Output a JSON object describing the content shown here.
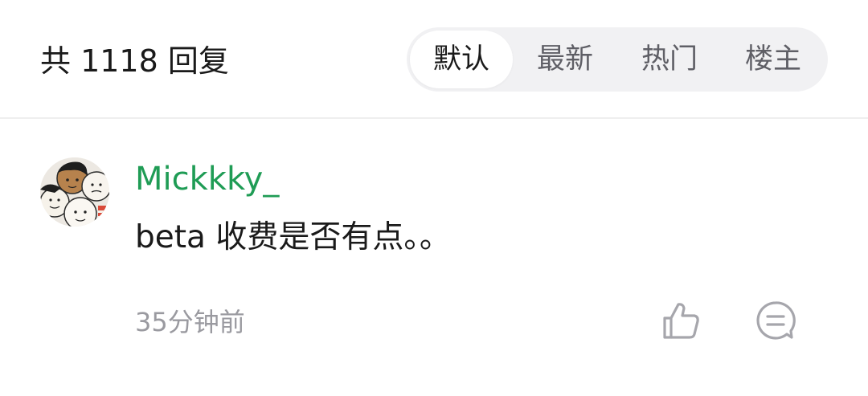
{
  "header": {
    "reply_count": "共 1118 回复",
    "sort_tabs": [
      {
        "label": "默认",
        "active": true
      },
      {
        "label": "最新",
        "active": false
      },
      {
        "label": "热门",
        "active": false
      },
      {
        "label": "楼主",
        "active": false
      }
    ]
  },
  "comment": {
    "avatar_icon": "avatar-cartoon-icon",
    "username": "Mickkky_",
    "text": "beta 收费是否有点。。",
    "time": "35分钟前",
    "actions": {
      "like_icon": "thumbs-up-icon",
      "reply_icon": "comment-bubble-icon"
    }
  },
  "colors": {
    "username": "#1f9c55",
    "secondary_text": "#9a9aa0",
    "tab_background": "#f1f1f3",
    "active_tab": "#ffffff"
  }
}
